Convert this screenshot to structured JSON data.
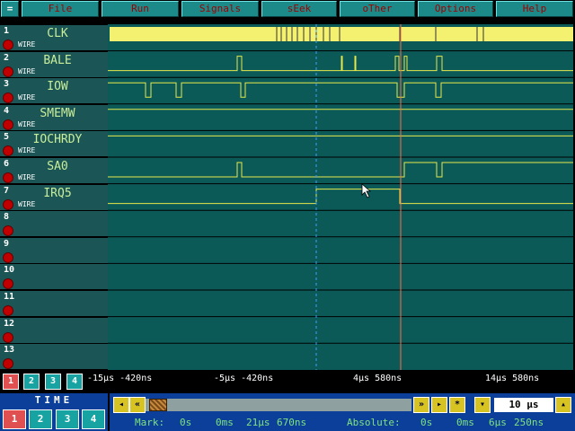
{
  "menu": {
    "system": "=",
    "items": [
      "File",
      "Run",
      "Signals",
      "sEek",
      "oTher",
      "Options",
      "Help"
    ]
  },
  "channels": [
    {
      "num": "1",
      "name": "CLK",
      "type": "WIRE"
    },
    {
      "num": "2",
      "name": "BALE",
      "type": "WIRE"
    },
    {
      "num": "3",
      "name": "IOW",
      "type": "WIRE"
    },
    {
      "num": "4",
      "name": "SMEMW",
      "type": "WIRE"
    },
    {
      "num": "5",
      "name": "IOCHRDY",
      "type": "WIRE"
    },
    {
      "num": "6",
      "name": "SA0",
      "type": "WIRE"
    },
    {
      "num": "7",
      "name": "IRQ5",
      "type": "WIRE"
    },
    {
      "num": "8",
      "name": "",
      "type": ""
    },
    {
      "num": "9",
      "name": "",
      "type": ""
    },
    {
      "num": "10",
      "name": "",
      "type": ""
    },
    {
      "num": "11",
      "name": "",
      "type": ""
    },
    {
      "num": "12",
      "name": "",
      "type": ""
    },
    {
      "num": "13",
      "name": "",
      "type": ""
    }
  ],
  "pages": [
    "1",
    "2",
    "3",
    "4"
  ],
  "axis_labels": [
    "-15µs -420ns",
    "-5µs -420ns",
    "4µs 580ns",
    "14µs 580ns"
  ],
  "time_panel": {
    "title": "TIME",
    "buttons": [
      "1",
      "2",
      "3",
      "4"
    ]
  },
  "controls": {
    "rewind": "◂",
    "fast_back": "«",
    "fast_fwd": "»",
    "play": "▸",
    "star": "*",
    "zoom_down": "▾",
    "zoom_value": "10 µs",
    "zoom_up": "▴"
  },
  "mark": {
    "label": "Mark:",
    "s": "0s",
    "ms": "0ms",
    "us": "21µs",
    "ns": "670ns"
  },
  "absolute": {
    "label": "Absolute:",
    "s": "0s",
    "ms": "0ms",
    "us": "6µs",
    "ns": "250ns"
  },
  "colors": {
    "wave_bg": "#0b5a58",
    "signal": "#e8e84a",
    "clk_fill": "#f4f070",
    "mark_cursor": "#3aa0ff",
    "abs_cursor": "#ff6a4a",
    "grid": "#2f7f7c"
  }
}
